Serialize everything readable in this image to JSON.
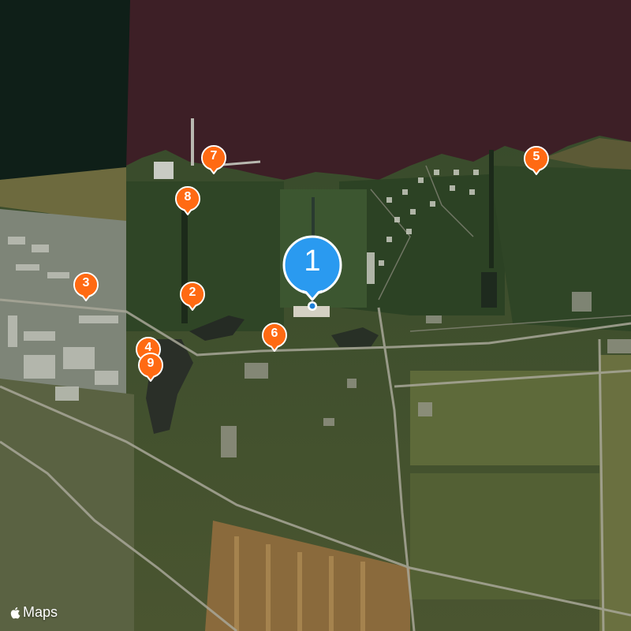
{
  "map": {
    "type": "satellite",
    "attribution": "Maps",
    "colors": {
      "water": "#3d1f26",
      "water_dark": "#0f1f18",
      "forest": "#2f4526",
      "field": "#5e6a3a",
      "urban": "#8a8f86",
      "marker_orange": "#ff6a13",
      "marker_blue": "#2a9af0"
    }
  },
  "markers": [
    {
      "label": "1",
      "primary": true
    },
    {
      "label": "2"
    },
    {
      "label": "3"
    },
    {
      "label": "4"
    },
    {
      "label": "5"
    },
    {
      "label": "6"
    },
    {
      "label": "7"
    },
    {
      "label": "8"
    },
    {
      "label": "9"
    }
  ]
}
